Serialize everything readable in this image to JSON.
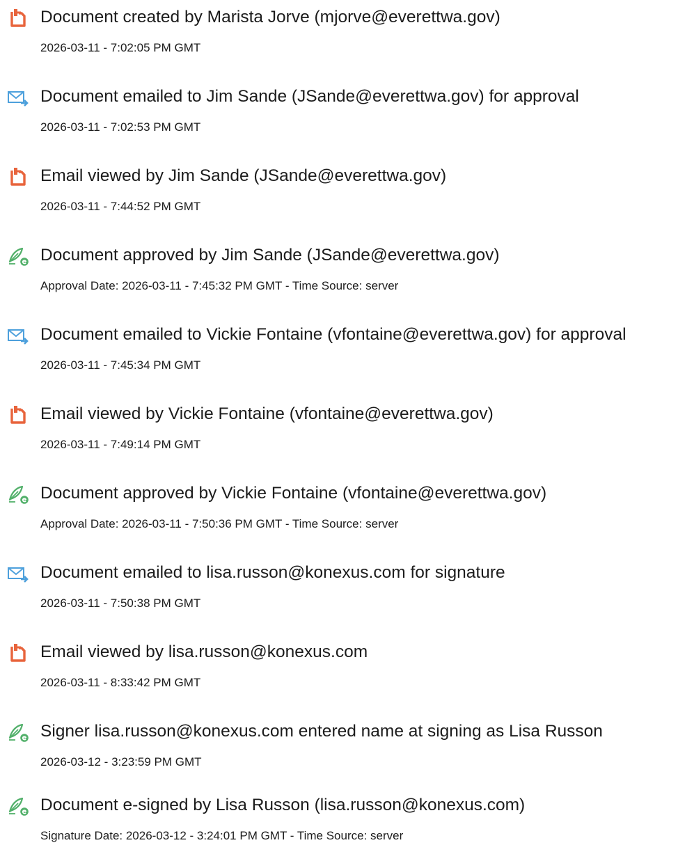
{
  "events": [
    {
      "icon": "document-created-icon",
      "title": "Document created by Marista Jorve (mjorve@everettwa.gov)",
      "date": "2026-03-11 - 7:02:05 PM GMT"
    },
    {
      "icon": "email-sent-icon",
      "title": "Document emailed to Jim Sande (JSande@everettwa.gov) for approval",
      "date": "2026-03-11 - 7:02:53 PM GMT"
    },
    {
      "icon": "document-viewed-icon",
      "title": "Email viewed by Jim Sande (JSande@everettwa.gov)",
      "date": "2026-03-11 - 7:44:52 PM GMT"
    },
    {
      "icon": "pen-approved-icon",
      "title": "Document approved by Jim Sande (JSande@everettwa.gov)",
      "date": "Approval Date: 2026-03-11 - 7:45:32 PM GMT - Time Source: server"
    },
    {
      "icon": "email-sent-icon",
      "title": "Document emailed to Vickie Fontaine (vfontaine@everettwa.gov) for approval",
      "date": "2026-03-11 - 7:45:34 PM GMT"
    },
    {
      "icon": "document-viewed-icon",
      "title": "Email viewed by Vickie Fontaine (vfontaine@everettwa.gov)",
      "date": "2026-03-11 - 7:49:14 PM GMT"
    },
    {
      "icon": "pen-approved-icon",
      "title": "Document approved by Vickie Fontaine (vfontaine@everettwa.gov)",
      "date": "Approval Date: 2026-03-11 - 7:50:36 PM GMT - Time Source: server"
    },
    {
      "icon": "email-sent-icon",
      "title": "Document emailed to lisa.russon@konexus.com for signature",
      "date": "2026-03-11 - 7:50:38 PM GMT"
    },
    {
      "icon": "document-viewed-icon",
      "title": "Email viewed by lisa.russon@konexus.com",
      "date": "2026-03-11 - 8:33:42 PM GMT"
    },
    {
      "icon": "pen-signed-icon",
      "title": "Signer lisa.russon@konexus.com entered name at signing as Lisa Russon",
      "date": "2026-03-12 - 3:23:59 PM GMT"
    },
    {
      "icon": "pen-signed-icon",
      "title": "Document e-signed by Lisa Russon (lisa.russon@konexus.com)",
      "date": "Signature Date: 2026-03-12 - 3:24:01 PM GMT - Time Source: server"
    }
  ],
  "colors": {
    "document_icon": "#e8643c",
    "email_icon": "#4da0dc",
    "pen_icon": "#52b06a"
  }
}
